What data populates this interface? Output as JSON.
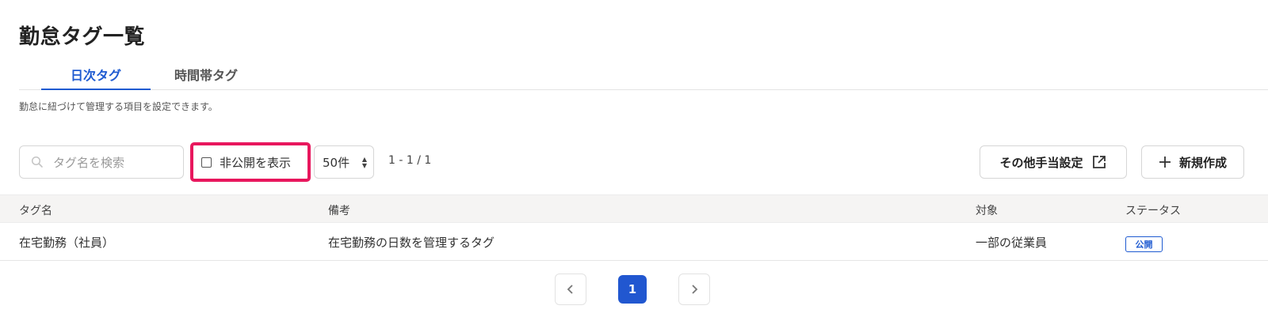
{
  "page": {
    "title": "勤怠タグ一覧",
    "description": "勤怠に紐づけて管理する項目を設定できます。"
  },
  "tabs": [
    {
      "label": "日次タグ",
      "active": true
    },
    {
      "label": "時間帯タグ",
      "active": false
    }
  ],
  "toolbar": {
    "search_placeholder": "タグ名を検索",
    "show_hidden_label": "非公開を表示",
    "show_hidden_checked": false,
    "per_page": "50件",
    "range": "1 - 1 / 1",
    "other_allowance_label": "その他手当設定",
    "new_label": "新規作成"
  },
  "table": {
    "columns": [
      "タグ名",
      "備考",
      "対象",
      "ステータス"
    ],
    "rows": [
      {
        "name": "在宅勤務（社員）",
        "note": "在宅勤務の日数を管理するタグ",
        "target": "一部の従業員",
        "status": "公開"
      }
    ]
  },
  "pagination": {
    "current_page": "1"
  },
  "colors": {
    "accent": "#2157d0",
    "highlight": "#e8175d"
  },
  "icons": {
    "search": "search-icon",
    "external": "external-link-icon",
    "plus": "plus-icon",
    "prev": "chevron-left-icon",
    "next": "chevron-right-icon",
    "select_arrows": "sort-arrows-icon"
  }
}
